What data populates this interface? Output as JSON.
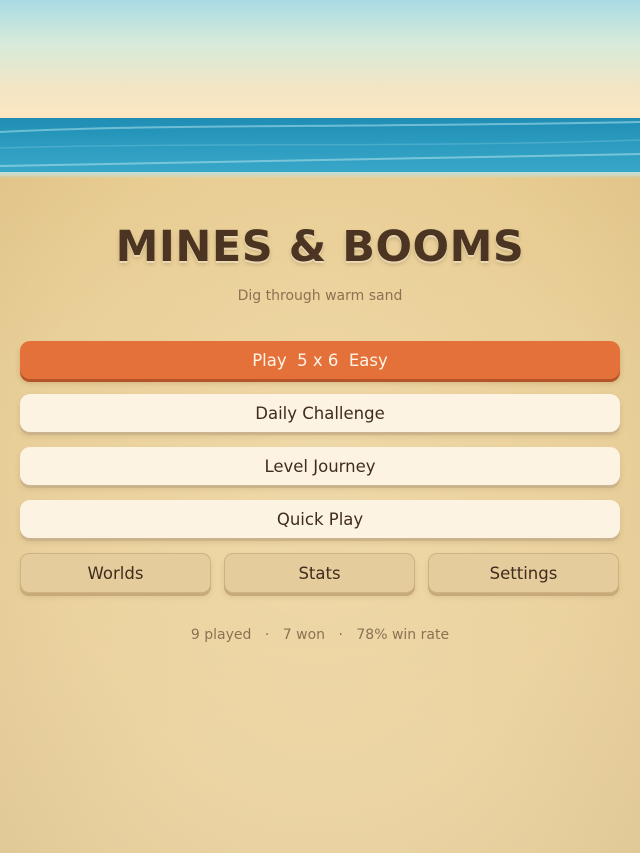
{
  "title": "MINES & BOOMS",
  "subtitle": "Dig through warm sand",
  "menu": {
    "play_label": "Play  5 x 6  Easy",
    "daily_label": "Daily Challenge",
    "journey_label": "Level Journey",
    "quick_label": "Quick Play",
    "worlds_label": "Worlds",
    "stats_label": "Stats",
    "settings_label": "Settings"
  },
  "stats": {
    "played": "9 played",
    "won": "7 won",
    "win_rate": "78% win rate",
    "separator": "·"
  },
  "colors": {
    "primary": "#e4713a",
    "title": "#4b3421",
    "sea": "#2b9bbf",
    "sand": "#e9cf98"
  }
}
